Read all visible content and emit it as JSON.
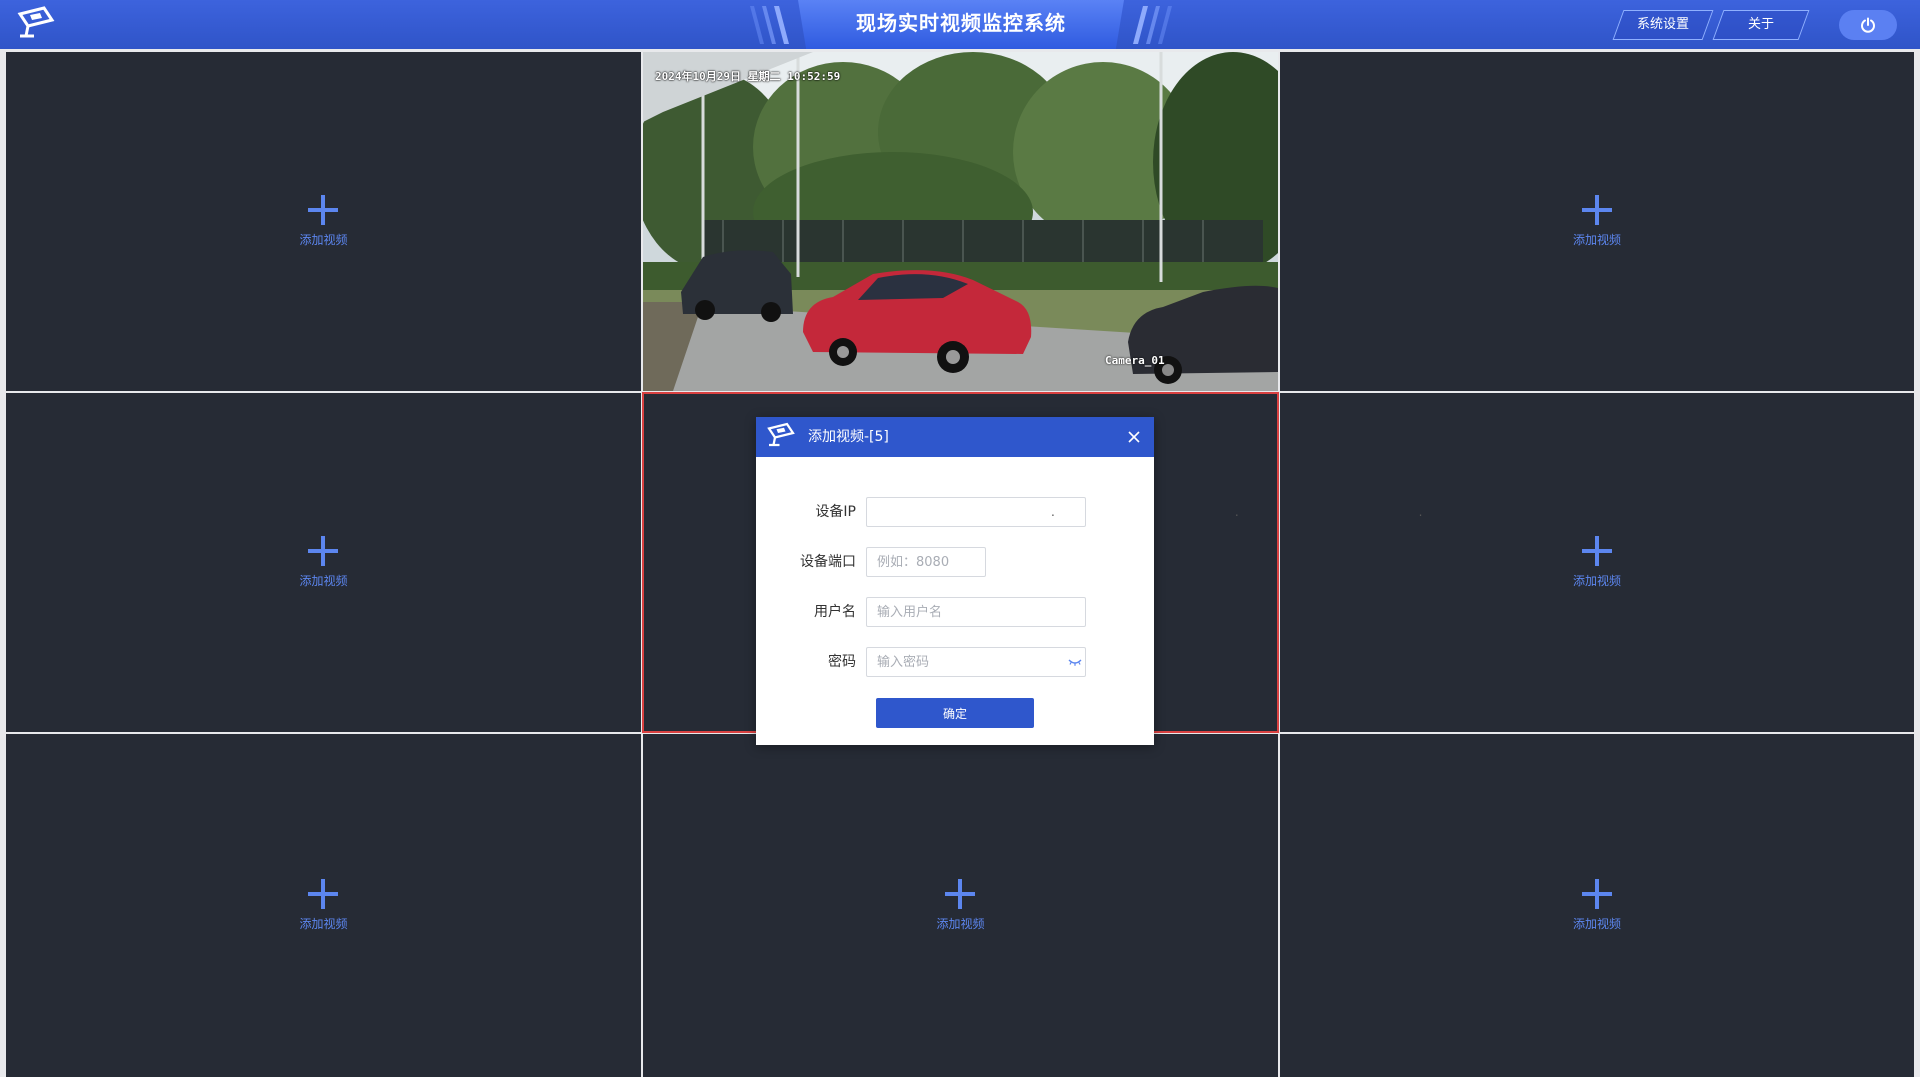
{
  "app": {
    "title": "现场实时视频监控系统",
    "menu": [
      {
        "label": "系统设置"
      },
      {
        "label": "关于"
      }
    ]
  },
  "grid": {
    "add_label": "添加视频",
    "cells": [
      {
        "index": 1,
        "state": "empty"
      },
      {
        "index": 2,
        "state": "playing"
      },
      {
        "index": 3,
        "state": "empty"
      },
      {
        "index": 4,
        "state": "empty"
      },
      {
        "index": 5,
        "state": "selected"
      },
      {
        "index": 6,
        "state": "empty"
      },
      {
        "index": 7,
        "state": "empty"
      },
      {
        "index": 8,
        "state": "empty"
      },
      {
        "index": 9,
        "state": "empty"
      }
    ]
  },
  "feed": {
    "timestamp": "2024年10月29日 星期二 10:52:59",
    "camera_name": "Camera_01"
  },
  "dialog": {
    "title": "添加视频-[5]",
    "fields": {
      "ip": {
        "label": "设备IP"
      },
      "port": {
        "label": "设备端口",
        "placeholder": "例如：8080"
      },
      "username": {
        "label": "用户名",
        "placeholder": "输入用户名"
      },
      "password": {
        "label": "密码",
        "placeholder": "输入密码"
      }
    },
    "confirm_label": "确定"
  },
  "colors": {
    "header": "#2f54c8",
    "accent": "#5c86ef",
    "cell_bg": "#262b35",
    "selected_border": "#d94141"
  }
}
